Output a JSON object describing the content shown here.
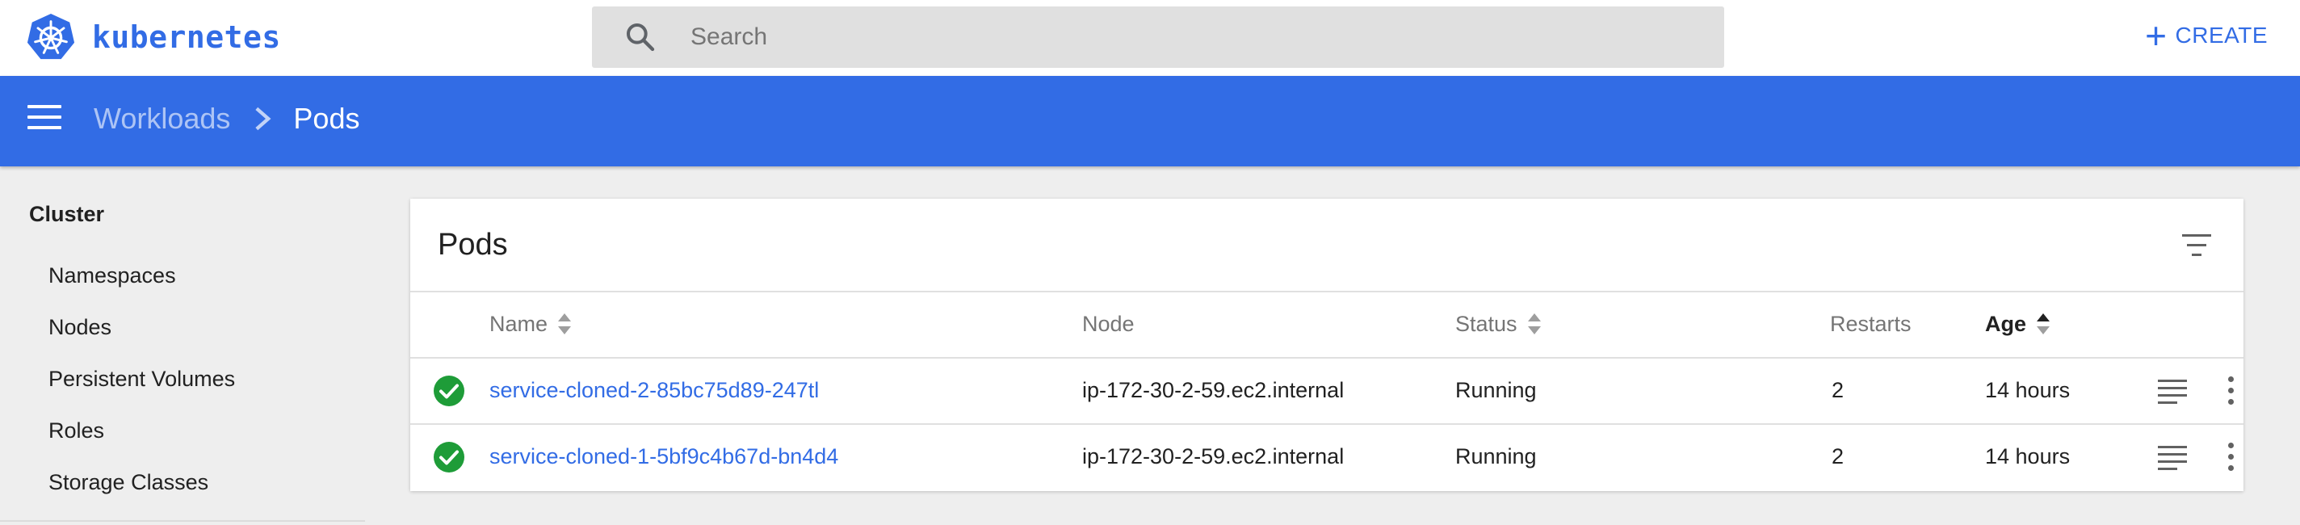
{
  "app": {
    "brand": "kubernetes",
    "logo_icon": "kubernetes-helm-wheel-icon",
    "accent_color": "#326ce5"
  },
  "search": {
    "placeholder": "Search",
    "value": ""
  },
  "toolbar": {
    "create_label": "CREATE"
  },
  "header": {
    "breadcrumb_parent": "Workloads",
    "breadcrumb_current": "Pods"
  },
  "sidebar": {
    "section_title": "Cluster",
    "items": [
      {
        "label": "Namespaces"
      },
      {
        "label": "Nodes"
      },
      {
        "label": "Persistent Volumes"
      },
      {
        "label": "Roles"
      },
      {
        "label": "Storage Classes"
      }
    ]
  },
  "pods": {
    "title": "Pods",
    "columns": {
      "name": "Name",
      "node": "Node",
      "status": "Status",
      "restarts": "Restarts",
      "age": "Age"
    },
    "sorted_column": "age",
    "rows": [
      {
        "status_icon": "check-circle-icon",
        "name": "service-cloned-2-85bc75d89-247tl",
        "node": "ip-172-30-2-59.ec2.internal",
        "status": "Running",
        "restarts": "2",
        "age": "14 hours"
      },
      {
        "status_icon": "check-circle-icon",
        "name": "service-cloned-1-5bf9c4b67d-bn4d4",
        "node": "ip-172-30-2-59.ec2.internal",
        "status": "Running",
        "restarts": "2",
        "age": "14 hours"
      }
    ],
    "status_color": "#1e9c38"
  }
}
